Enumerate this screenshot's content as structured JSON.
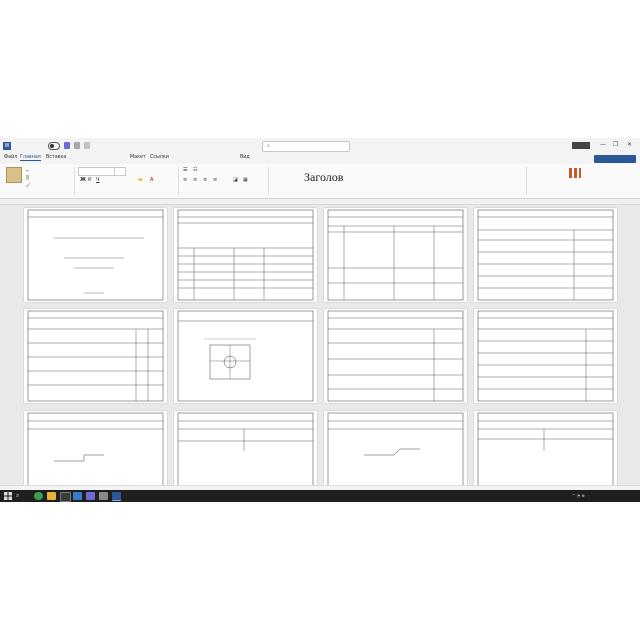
{
  "window": {
    "app_icon": "W",
    "quick_icons": [
      "save-icon",
      "undo-icon",
      "redo-icon"
    ],
    "user_badge": "",
    "controls": [
      "—",
      "❐",
      "✕"
    ]
  },
  "ribbon": {
    "tabs": [
      {
        "label": "Файл"
      },
      {
        "label": "Главная"
      },
      {
        "label": "Вставка"
      },
      {
        "label": "Макет"
      },
      {
        "label": "Ссылки"
      },
      {
        "label": "Вид"
      }
    ],
    "share_label": "",
    "clipboard": {
      "paste_label": ""
    },
    "font": {
      "name": "",
      "size": ""
    },
    "styles": [
      {
        "label": "Заголов"
      }
    ],
    "editing": []
  },
  "pages": [
    {
      "tag": "",
      "title": "",
      "big": ""
    },
    {
      "tag": "",
      "title": "",
      "big": ""
    },
    {
      "tag": "",
      "title": "",
      "big": ""
    },
    {
      "tag": "",
      "title": "",
      "big": ""
    },
    {
      "tag": "",
      "title": "",
      "big": ""
    },
    {
      "tag": "",
      "title": "",
      "big": ""
    },
    {
      "tag": "",
      "title": "",
      "big": ""
    },
    {
      "tag": "",
      "title": "",
      "big": ""
    },
    {
      "tag": "",
      "title": "",
      "big": ""
    },
    {
      "tag": "",
      "title": "",
      "big": ""
    },
    {
      "tag": "",
      "title": "",
      "big": ""
    },
    {
      "tag": "",
      "title": "",
      "big": ""
    }
  ],
  "status": {
    "text": ""
  },
  "taskbar": {
    "apps": [
      "chrome-icon",
      "files-icon",
      "terminal-icon",
      "photos-icon",
      "save-icon",
      "settings-icon",
      "word-icon"
    ],
    "tray_text": "",
    "clock": "",
    "date": ""
  },
  "colors": {
    "accent": "#2b5797",
    "taskbar": "#1f1f1f"
  }
}
